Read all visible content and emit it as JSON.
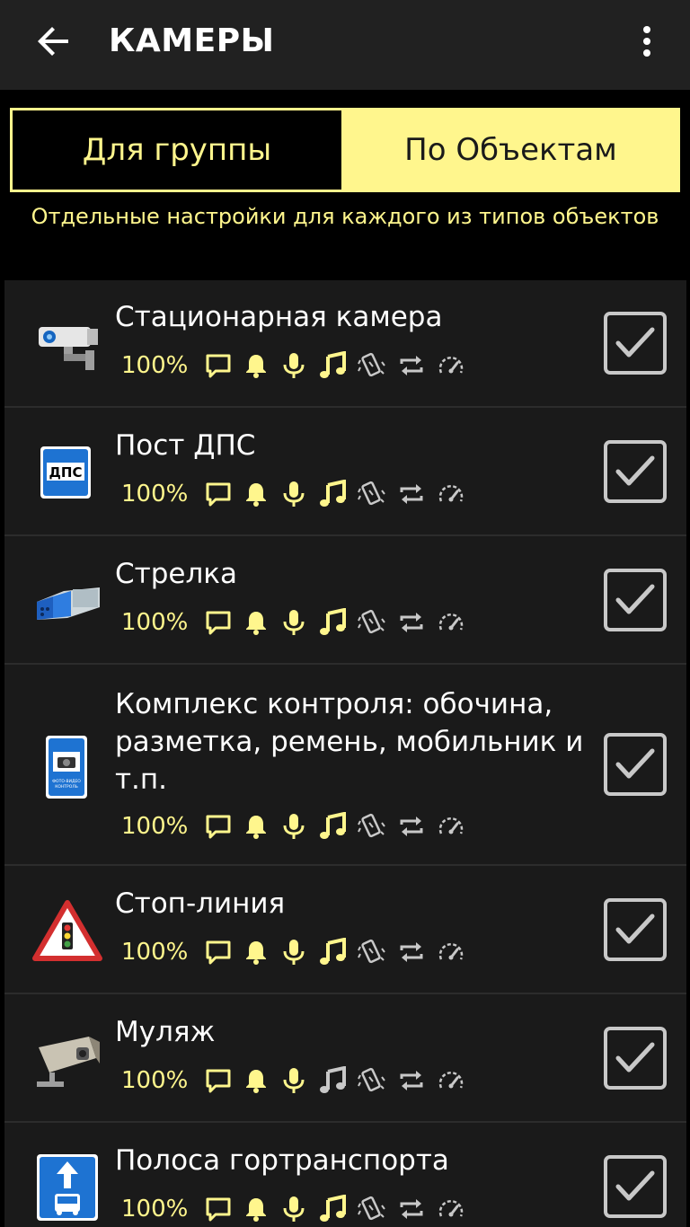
{
  "appbar": {
    "title": "КАМЕРЫ",
    "back_icon": "arrow-back-icon",
    "menu_icon": "more-vert-icon"
  },
  "segments": {
    "group": "Для группы",
    "objects": "По Объектам",
    "selected": "group"
  },
  "subtitle": "Отдельные настройки для каждого из типов объектов",
  "colors": {
    "accent": "#fff68d",
    "background": "#000000",
    "appbar": "#212121",
    "list_bg": "#1a1a1a",
    "icon_inactive": "#c8c8c8"
  },
  "items": [
    {
      "name": "Стационарная камера",
      "percent": "100%",
      "icon": "stationary-camera-icon",
      "music_active": true,
      "checked": true
    },
    {
      "name": "Пост ДПС",
      "percent": "100%",
      "icon": "dps-post-sign-icon",
      "sign_text": "ДПС",
      "music_active": true,
      "checked": true
    },
    {
      "name": "Стрелка",
      "percent": "100%",
      "icon": "strelka-radar-icon",
      "music_active": true,
      "checked": true
    },
    {
      "name": "Комплекс контроля: обочина, разметка, ремень, мобильник и т.п.",
      "percent": "100%",
      "icon": "photo-video-control-sign-icon",
      "sign_text": "ФОТО-ВИДЕО КОНТРОЛЬ",
      "music_active": true,
      "checked": true
    },
    {
      "name": "Стоп-линия",
      "percent": "100%",
      "icon": "traffic-light-warning-sign-icon",
      "music_active": true,
      "checked": true
    },
    {
      "name": "Муляж",
      "percent": "100%",
      "icon": "dummy-camera-icon",
      "music_active": false,
      "checked": true
    },
    {
      "name": "Полоса гортранспорта",
      "percent": "100%",
      "icon": "bus-lane-sign-icon",
      "music_active": true,
      "checked": true
    }
  ]
}
